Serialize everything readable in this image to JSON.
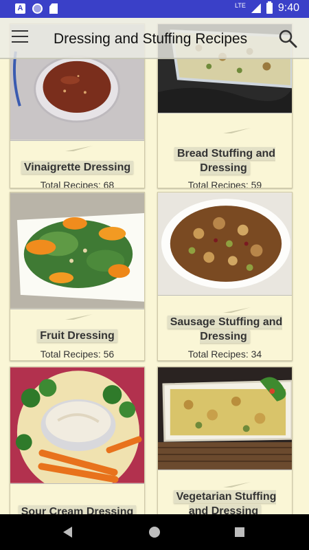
{
  "status_bar": {
    "network": "LTE",
    "time": "9:40"
  },
  "toolbar": {
    "title": "Dressing and Stuffing Recipes"
  },
  "count_prefix": "Total Recipes: ",
  "cards": [
    {
      "title": "Vinaigrette Dressing",
      "count": 68,
      "count_label": "Total Recipes: 68"
    },
    {
      "title": "Bread Stuffing and Dressing",
      "count": 59,
      "count_label": "Total Recipes: 59"
    },
    {
      "title": "Fruit Dressing",
      "count": 56,
      "count_label": "Total Recipes: 56"
    },
    {
      "title": "Sausage Stuffing and Dressing",
      "count": 34,
      "count_label": "Total Recipes: 34"
    },
    {
      "title": "Sour Cream Dressing",
      "count_label": ""
    },
    {
      "title": "Vegetarian Stuffing and Dressing",
      "count_label": ""
    }
  ],
  "colors": {
    "status_bar": "#3a40c8",
    "background": "#faf6d6",
    "title_chip": "#e2e0c6"
  }
}
